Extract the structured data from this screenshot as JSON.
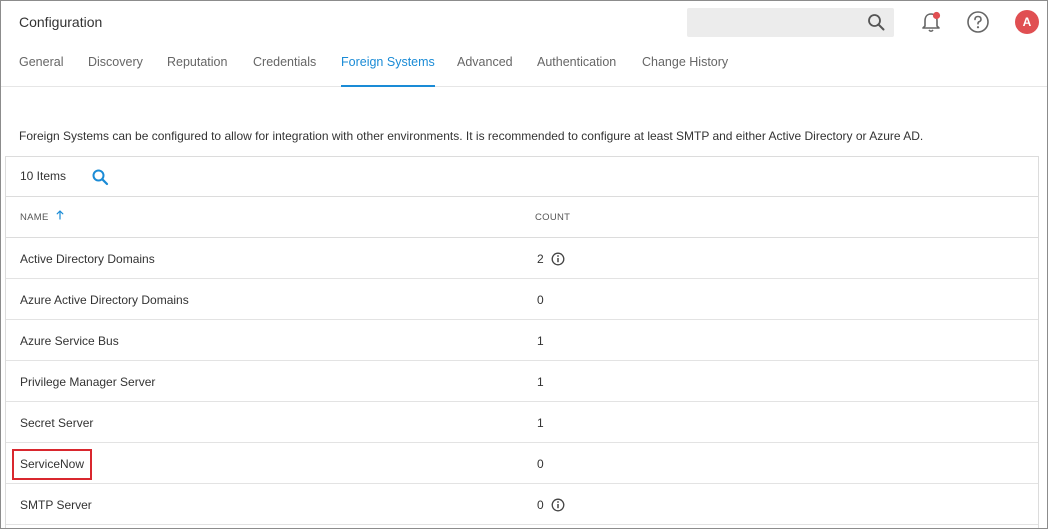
{
  "header": {
    "title": "Configuration",
    "search_placeholder": "",
    "avatar_initial": "A",
    "notification_dot_color": "#e04f52"
  },
  "tabs": [
    {
      "label": "General",
      "active": false
    },
    {
      "label": "Discovery",
      "active": false
    },
    {
      "label": "Reputation",
      "active": false
    },
    {
      "label": "Credentials",
      "active": false
    },
    {
      "label": "Foreign Systems",
      "active": true
    },
    {
      "label": "Advanced",
      "active": false
    },
    {
      "label": "Authentication",
      "active": false
    },
    {
      "label": "Change History",
      "active": false
    }
  ],
  "description": "Foreign Systems can be configured to allow for integration with other environments. It is recommended to configure at least SMTP and either Active Directory or Azure AD.",
  "table": {
    "item_count": "10 Items",
    "columns": {
      "name": "NAME",
      "count": "COUNT"
    },
    "sort": {
      "column": "name",
      "direction": "ascending"
    },
    "rows": [
      {
        "name": "Active Directory Domains",
        "count": "2",
        "info": true
      },
      {
        "name": "Azure Active Directory Domains",
        "count": "0",
        "info": false
      },
      {
        "name": "Azure Service Bus",
        "count": "1",
        "info": false
      },
      {
        "name": "Privilege Manager Server",
        "count": "1",
        "info": false
      },
      {
        "name": "Secret Server",
        "count": "1",
        "info": false
      },
      {
        "name": "ServiceNow",
        "count": "0",
        "info": false,
        "highlighted": true
      },
      {
        "name": "SMTP Server",
        "count": "0",
        "info": true
      }
    ]
  },
  "colors": {
    "accent": "#1a8bd6",
    "highlight_border": "#d9272e"
  }
}
